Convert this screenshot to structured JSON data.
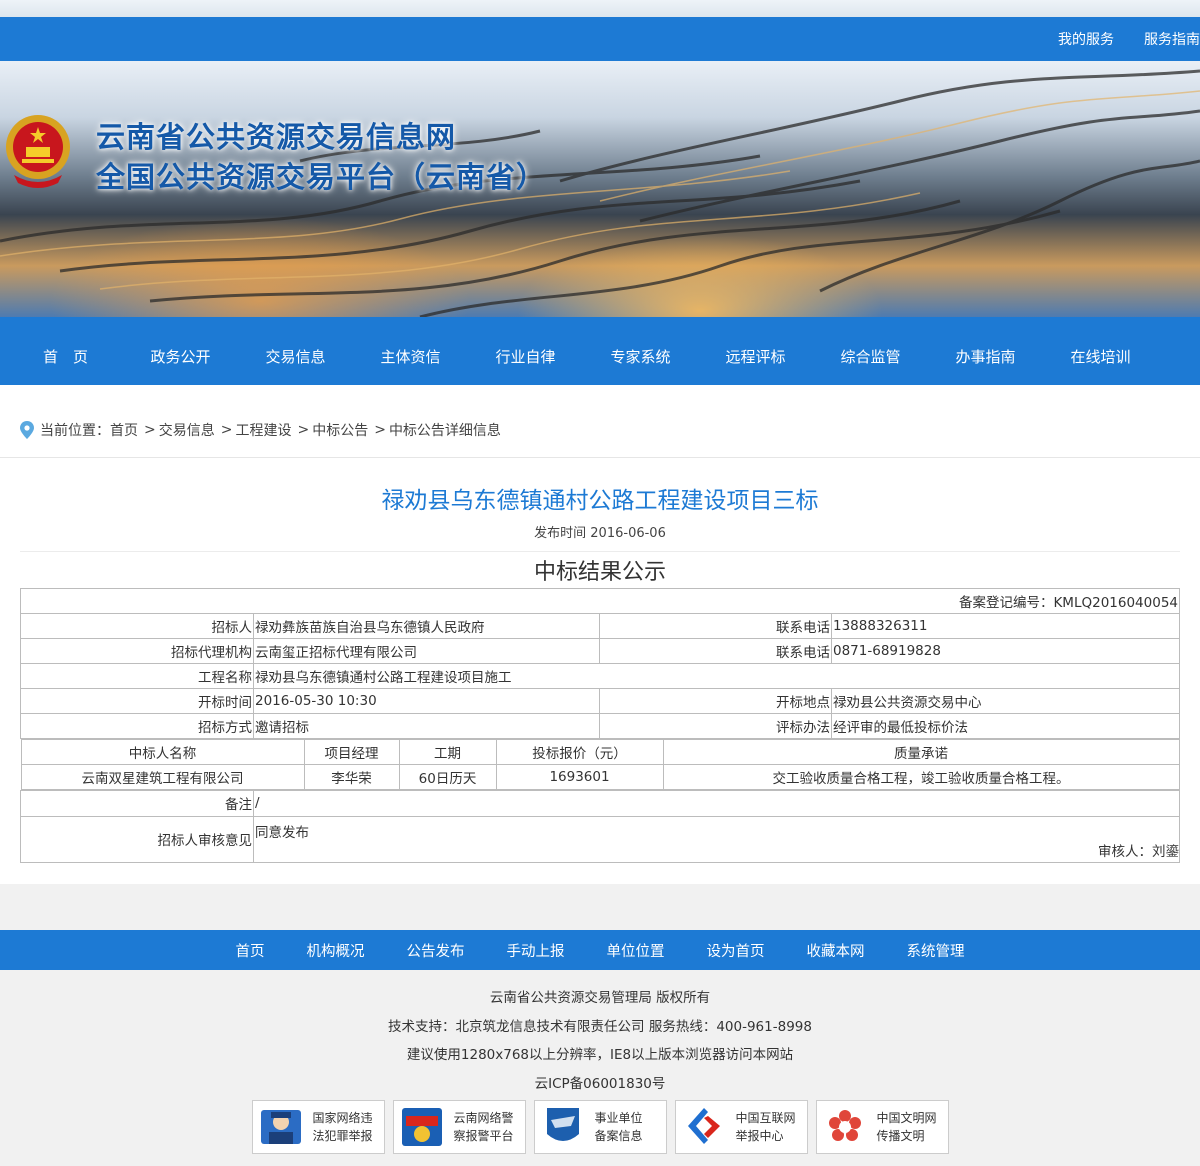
{
  "header": {
    "links": [
      "我的服务",
      "服务指南"
    ],
    "title_line1": "云南省公共资源交易信息网",
    "title_line2": "全国公共资源交易平台（云南省）"
  },
  "nav": [
    "首　页",
    "政务公开",
    "交易信息",
    "主体资信",
    "行业自律",
    "专家系统",
    "远程评标",
    "综合监管",
    "办事指南",
    "在线培训"
  ],
  "breadcrumb": {
    "prefix": "当前位置：",
    "items": [
      "首页",
      "交易信息",
      "工程建设",
      "中标公告",
      "中标公告详细信息"
    ]
  },
  "article": {
    "title": "禄劝县乌东德镇通村公路工程建设项目三标",
    "date": "发布时间 2016-06-06",
    "table": {
      "heading": "中标结果公示",
      "record_no": "备案登记编号：KMLQ2016040054",
      "rows": [
        {
          "l1": "招标人",
          "v1": "禄劝彝族苗族自治县乌东德镇人民政府",
          "l2": "联系电话",
          "v2": "13888326311"
        },
        {
          "l1": "招标代理机构",
          "v1": "云南玺正招标代理有限公司",
          "l2": "联系电话",
          "v2": "0871-68919828"
        },
        {
          "l1": "开标时间",
          "v1": "2016-05-30 10:30",
          "l2": "开标地点",
          "v2": "禄劝县公共资源交易中心"
        },
        {
          "l1": "招标方式",
          "v1": "邀请招标",
          "l2": "评标办法",
          "v2": "经评审的最低投标价法"
        }
      ],
      "project_label": "工程名称",
      "project_value": "禄劝县乌东德镇通村公路工程建设项目施工",
      "winner_headers": [
        "中标人名称",
        "项目经理",
        "工期",
        "投标报价（元）",
        "质量承诺"
      ],
      "winner_row": [
        "云南双星建筑工程有限公司",
        "李华荣",
        "60日历天",
        "1693601",
        "交工验收质量合格工程，竣工验收质量合格工程。"
      ],
      "remark_label": "备注",
      "remark_value": "/",
      "review_label": "招标人审核意见",
      "review_value": "同意发布",
      "reviewer": "审核人：刘鎏"
    }
  },
  "footer_nav": [
    "首页",
    "机构概况",
    "公告发布",
    "手动上报",
    "单位位置",
    "设为首页",
    "收藏本网",
    "系统管理"
  ],
  "footer": {
    "lines": [
      "云南省公共资源交易管理局 版权所有",
      "技术支持：北京筑龙信息技术有限责任公司 服务热线：400-961-8998",
      "建议使用1280x768以上分辨率，IE8以上版本浏览器访问本网站",
      "云ICP备06001830号"
    ],
    "badges": [
      {
        "l1": "国家网络违",
        "l2": "法犯罪举报",
        "icon": "police-icon"
      },
      {
        "l1": "云南网络警",
        "l2": "察报警平台",
        "icon": "police-badge-icon"
      },
      {
        "l1": "事业单位",
        "l2": "备案信息",
        "icon": "institution-icon"
      },
      {
        "l1": "中国互联网",
        "l2": "举报中心",
        "icon": "report-center-icon"
      },
      {
        "l1": "中国文明网",
        "l2": "传播文明",
        "icon": "civilization-icon"
      }
    ]
  }
}
